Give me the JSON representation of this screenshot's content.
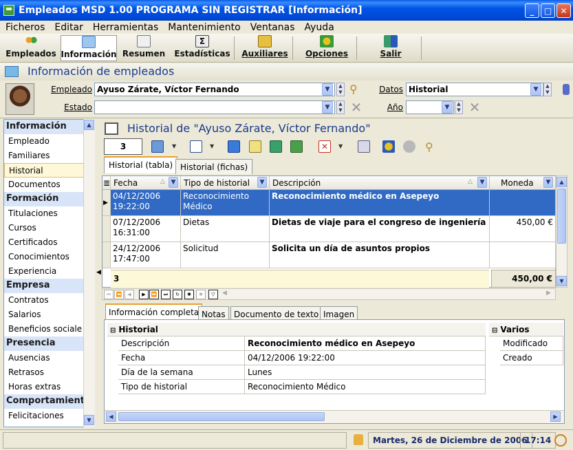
{
  "window": {
    "title": "Empleados MSD 1.00 PROGRAMA SIN REGISTRAR [Información]"
  },
  "menu": [
    "Ficheros",
    "Editar",
    "Herramientas",
    "Mantenimiento",
    "Ventanas",
    "Ayuda"
  ],
  "toolbar": {
    "empleados": "Empleados",
    "informacion": "Información",
    "resumen": "Resumen",
    "estadisticas": "Estadísticas",
    "auxiliares": "Auxiliares",
    "opciones": "Opciones",
    "salir": "Salir"
  },
  "section": {
    "title": "Información de empleados"
  },
  "employee": {
    "label": "Empleado",
    "value": "Ayuso Zárate, Víctor Fernando",
    "datos_label": "Datos",
    "datos_value": "Historial",
    "estado_label": "Estado",
    "estado_value": "",
    "anio_label": "Año",
    "anio_value": ""
  },
  "sidebar": {
    "groups": [
      {
        "title": "Información",
        "items": [
          "Empleado",
          "Familiares",
          "Historial",
          "Documentos"
        ]
      },
      {
        "title": "Formación",
        "items": [
          "Titulaciones",
          "Cursos",
          "Certificados",
          "Conocimientos",
          "Experiencia"
        ]
      },
      {
        "title": "Empresa",
        "items": [
          "Contratos",
          "Salarios",
          "Beneficios sociale"
        ]
      },
      {
        "title": "Presencia",
        "items": [
          "Ausencias",
          "Retrasos",
          "Horas extras"
        ]
      },
      {
        "title": "Comportamiento",
        "items": [
          "Felicitaciones"
        ]
      }
    ],
    "selected": "Historial"
  },
  "history": {
    "title": "Historial de \"Ayuso Zárate, Víctor Fernando\"",
    "count": "3",
    "tabs": [
      "Historial (tabla)",
      "Historial (fichas)"
    ],
    "columns": {
      "fecha": "Fecha",
      "tipo": "Tipo de historial",
      "descripcion": "Descripción",
      "moneda": "Moneda"
    },
    "rows": [
      {
        "fecha1": "04/12/2006",
        "fecha2": "19:22:00",
        "tipo1": "Reconocimiento",
        "tipo2": "Médico",
        "descripcion": "Reconocimiento médico en Asepeyo",
        "moneda": ""
      },
      {
        "fecha1": "07/12/2006",
        "fecha2": "16:31:00",
        "tipo1": "Dietas",
        "tipo2": "",
        "descripcion": "Dietas de viaje para el congreso de ingeniería",
        "moneda": "450,00 €"
      },
      {
        "fecha1": "24/12/2006",
        "fecha2": "17:47:00",
        "tipo1": "Solicitud",
        "tipo2": "",
        "descripcion": "Solicita un día de asuntos propios",
        "moneda": ""
      }
    ],
    "footer_count": "3",
    "footer_total": "450,00 €"
  },
  "detail": {
    "tabs": [
      "Información completa",
      "Notas",
      "Documento de texto",
      "Imagen"
    ],
    "category": "Historial",
    "props": [
      {
        "name": "Descripción",
        "value": "Reconocimiento médico en Asepeyo"
      },
      {
        "name": "Fecha",
        "value": "04/12/2006 19:22:00"
      },
      {
        "name": "Día de la semana",
        "value": "Lunes"
      },
      {
        "name": "Tipo de historial",
        "value": "Reconocimiento Médico"
      }
    ],
    "category2": "Varios",
    "props2": [
      "Modificado",
      "Creado"
    ]
  },
  "status": {
    "date": "Martes, 26 de Diciembre de 2006",
    "time": "17:14"
  }
}
